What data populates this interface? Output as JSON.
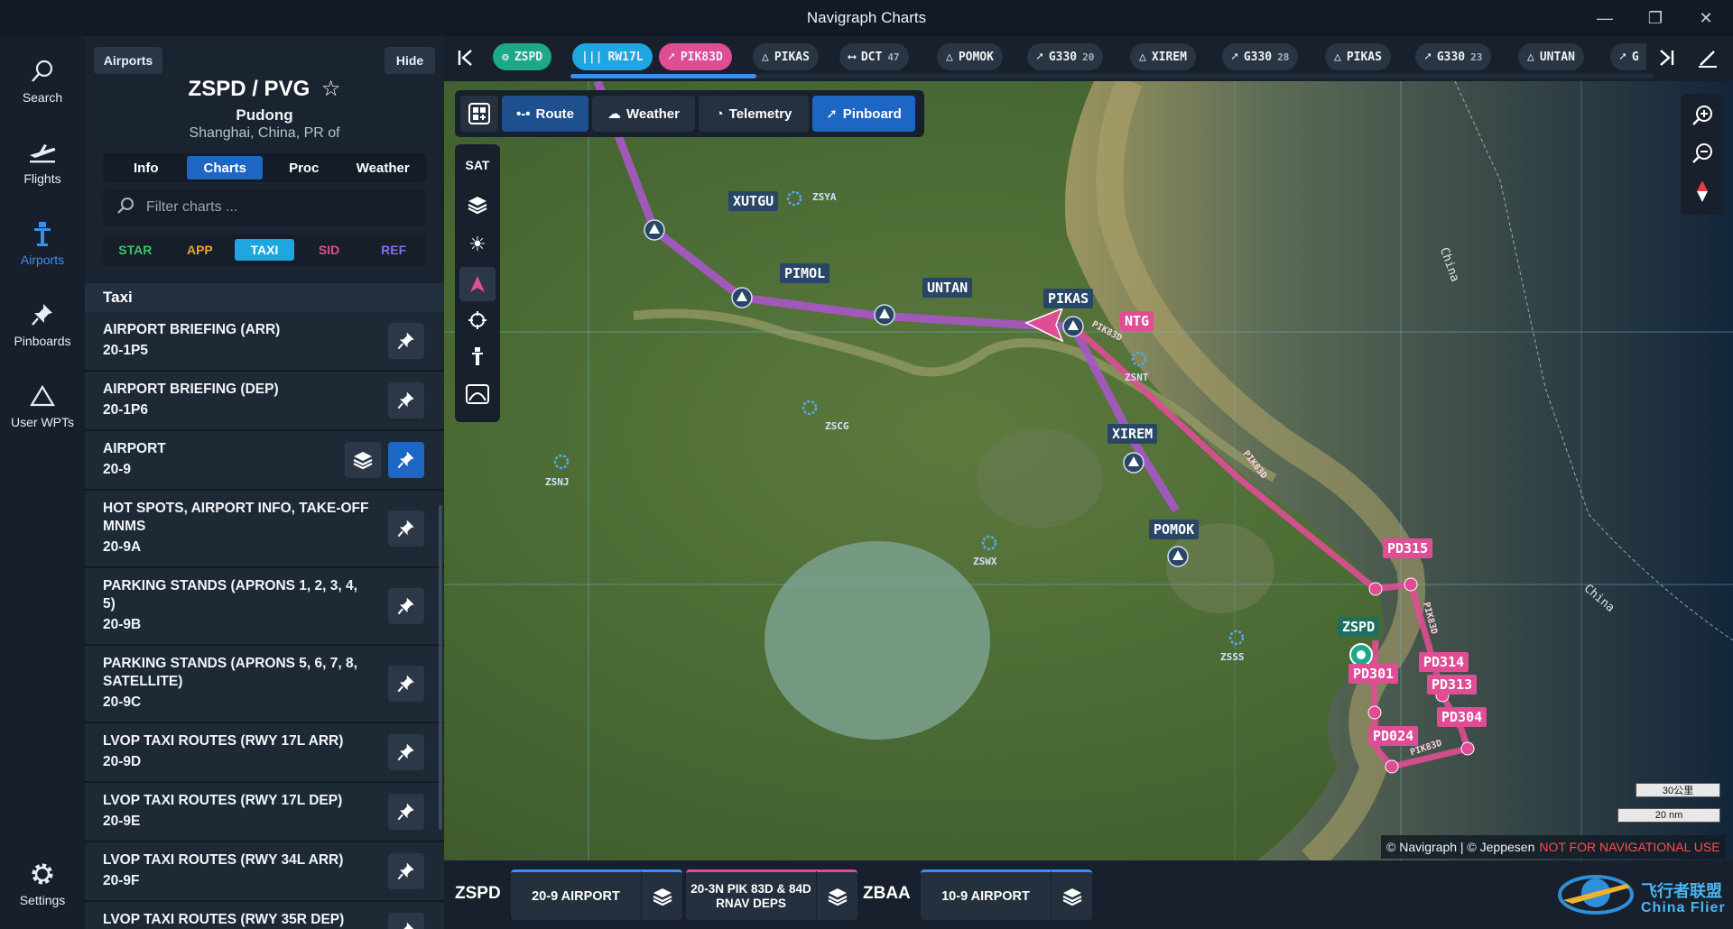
{
  "window": {
    "title": "Navigraph Charts"
  },
  "rail": {
    "items": [
      {
        "label": "Search",
        "icon": "search-icon"
      },
      {
        "label": "Flights",
        "icon": "plane-icon"
      },
      {
        "label": "Airports",
        "icon": "airport-icon"
      },
      {
        "label": "Pinboards",
        "icon": "pin-icon"
      },
      {
        "label": "User WPTs",
        "icon": "triangle-icon"
      }
    ],
    "settings_label": "Settings"
  },
  "panel": {
    "chip_label": "Airports",
    "hide_label": "Hide",
    "airport_title": "ZSPD / PVG",
    "airport_name": "Pudong",
    "airport_location": "Shanghai, China, PR of",
    "tabs": [
      "Info",
      "Charts",
      "Proc",
      "Weather"
    ],
    "active_tab": "Charts",
    "filter_placeholder": "Filter charts ...",
    "categories": [
      {
        "label": "STAR",
        "color": "#3ec46d"
      },
      {
        "label": "APP",
        "color": "#f0a030"
      },
      {
        "label": "TAXI",
        "color": "#ffffff"
      },
      {
        "label": "SID",
        "color": "#e04d95"
      },
      {
        "label": "REF",
        "color": "#8a6cf0"
      }
    ],
    "active_category": "TAXI",
    "section": "Taxi",
    "charts": [
      {
        "name": "AIRPORT BRIEFING (ARR)",
        "num": "20-1P5"
      },
      {
        "name": "AIRPORT BRIEFING (DEP)",
        "num": "20-1P6"
      },
      {
        "name": "AIRPORT",
        "num": "20-9"
      },
      {
        "name": "HOT SPOTS, AIRPORT INFO, TAKE-OFF MNMS",
        "num": "20-9A"
      },
      {
        "name": "PARKING STANDS (APRONS 1, 2, 3, 4, 5)",
        "num": "20-9B"
      },
      {
        "name": "PARKING STANDS (APRONS 5, 6, 7, 8, SATELLITE)",
        "num": "20-9C"
      },
      {
        "name": "LVOP TAXI ROUTES (RWY 17L ARR)",
        "num": "20-9D"
      },
      {
        "name": "LVOP TAXI ROUTES (RWY 17L DEP)",
        "num": "20-9E"
      },
      {
        "name": "LVOP TAXI ROUTES (RWY 34L ARR)",
        "num": "20-9F"
      },
      {
        "name": "LVOP TAXI ROUTES (RWY 35R DEP)",
        "num": ""
      }
    ]
  },
  "strip": {
    "items": [
      {
        "label": "ZSPD",
        "sub": "",
        "glyph": "✲",
        "bg": "#1ea88a"
      },
      {
        "label": "RW17L",
        "sub": "",
        "glyph": "|||",
        "bg": "#1da6e0"
      },
      {
        "label": "PIK83D",
        "sub": "",
        "glyph": "⟋",
        "bg": "#e04d95"
      },
      {
        "label": "PIKAS",
        "sub": "",
        "glyph": "△",
        "bg": "#2a3543"
      },
      {
        "label": "DCT",
        "sub": "47",
        "glyph": "⟷",
        "bg": "#2a3543"
      },
      {
        "label": "POMOK",
        "sub": "",
        "glyph": "△",
        "bg": "#2a3543"
      },
      {
        "label": "G330",
        "sub": "20",
        "glyph": "⟋",
        "bg": "#2a3543"
      },
      {
        "label": "XIREM",
        "sub": "",
        "glyph": "△",
        "bg": "#2a3543"
      },
      {
        "label": "G330",
        "sub": "28",
        "glyph": "⟋",
        "bg": "#2a3543"
      },
      {
        "label": "PIKAS",
        "sub": "",
        "glyph": "△",
        "bg": "#2a3543"
      },
      {
        "label": "G330",
        "sub": "23",
        "glyph": "⟋",
        "bg": "#2a3543"
      },
      {
        "label": "UNTAN",
        "sub": "",
        "glyph": "△",
        "bg": "#2a3543"
      },
      {
        "label": "G",
        "sub": "",
        "glyph": "⟋",
        "bg": "#2a3543"
      }
    ]
  },
  "map_toolbar": {
    "buttons": [
      {
        "label": "Route",
        "active": false
      },
      {
        "label": "Weather",
        "active": false
      },
      {
        "label": "Telemetry",
        "active": false
      },
      {
        "label": "Pinboard",
        "active": true
      }
    ],
    "sat_label": "SAT"
  },
  "map": {
    "waypoints": [
      "XUTGU",
      "PIMOL",
      "UNTAN",
      "PIKAS",
      "XIREM",
      "POMOK"
    ],
    "procedure_points": [
      "NTG",
      "PD315",
      "ZSPD",
      "PD301",
      "PD314",
      "PD313",
      "PD304",
      "PD024"
    ],
    "airports": [
      "ZSYA",
      "ZSNT",
      "ZSCG",
      "ZSNJ",
      "ZSWX",
      "ZSSS"
    ],
    "route_labels": [
      "PIK83D",
      "PIK83D",
      "PIK83D",
      "PIK83D"
    ],
    "region_labels": [
      "China",
      "China"
    ],
    "scale": {
      "km": "30公里",
      "nm": "20 nm"
    },
    "copyright": "© Navigraph | © Jeppesen",
    "warning": "NOT FOR NAVIGATIONAL USE",
    "colors": {
      "route": "#b45ad2",
      "procedure": "#e04d95",
      "waypoint_box": "#2a4666"
    }
  },
  "bottom": {
    "airport1": "ZSPD",
    "chip1": "20-9 AIRPORT",
    "chip2": "20-3N PIK 83D & 84D RNAV DEPS",
    "airport2": "ZBAA",
    "chip3": "10-9 AIRPORT"
  },
  "watermark": {
    "text_cn": "飞行者联盟",
    "text_en": "China Flier"
  }
}
